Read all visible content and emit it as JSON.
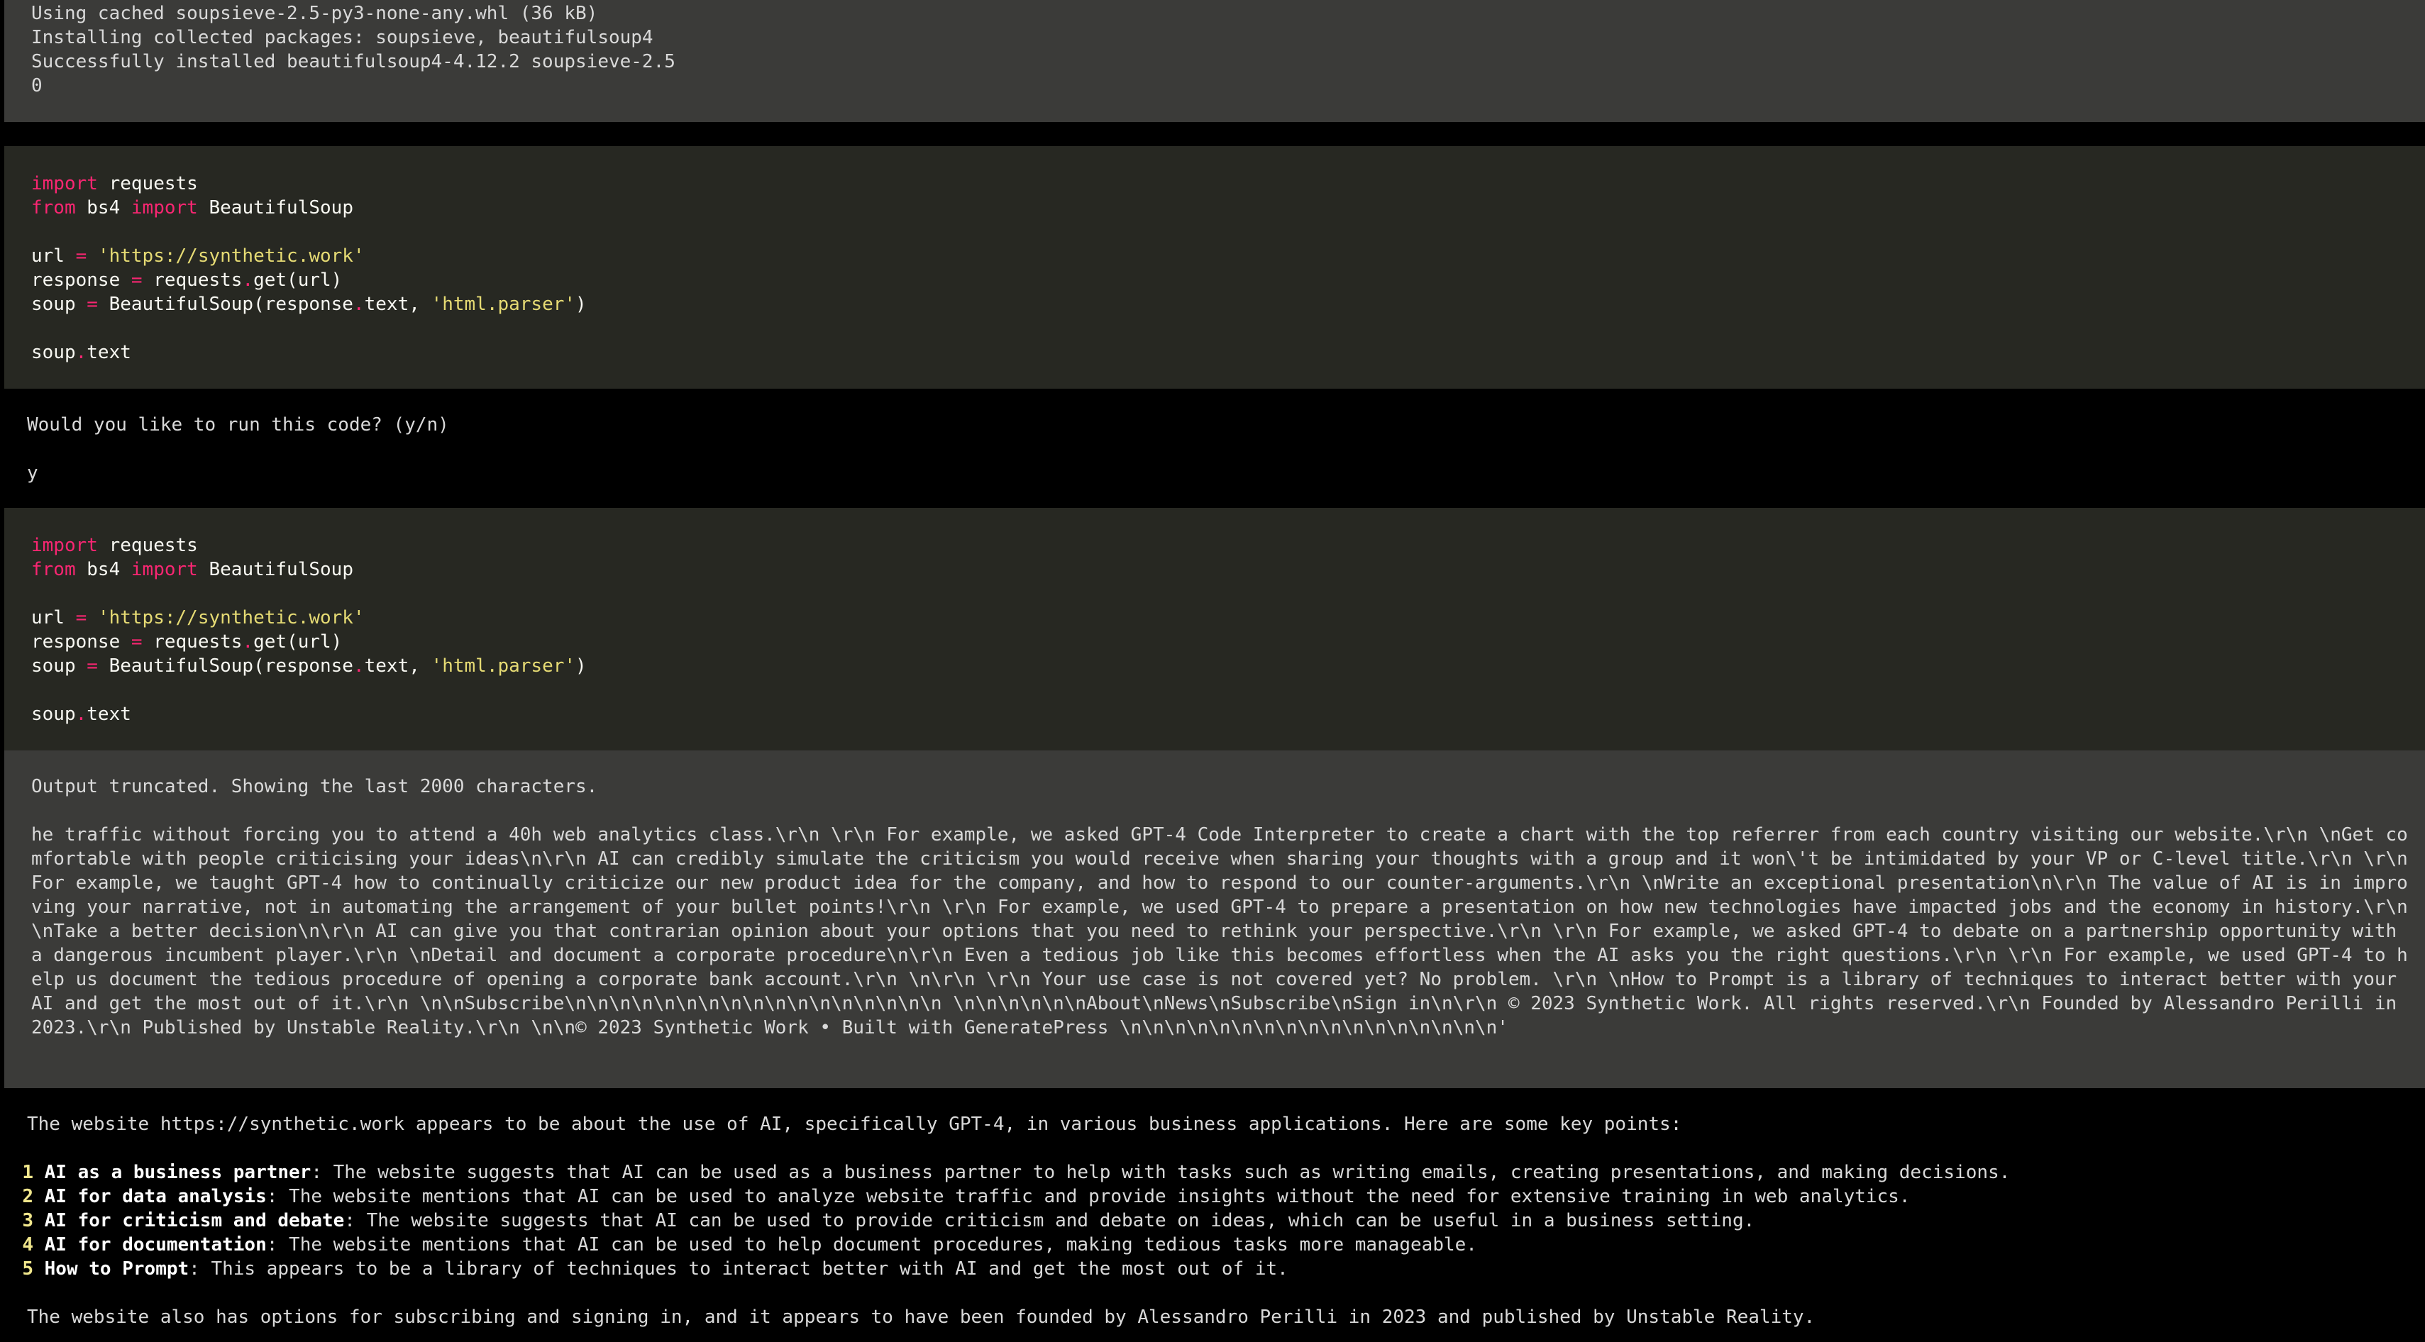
{
  "install_output": {
    "lines": [
      "Using cached soupsieve-2.5-py3-none-any.whl (36 kB)",
      "Installing collected packages: soupsieve, beautifulsoup4",
      "Successfully installed beautifulsoup4-4.12.2 soupsieve-2.5",
      "0"
    ]
  },
  "code_block_1": {
    "kw_import": "import",
    "mod_requests": " requests",
    "kw_from": "from",
    "mod_bs4": " bs4 ",
    "cls_bs": " BeautifulSoup",
    "url_var": "url ",
    "eq": "=",
    "url_val": "'https://synthetic.work'",
    "resp_pre": "response ",
    "resp_post_a": " requests",
    "dot": ".",
    "resp_post_b": "get(url)",
    "soup_pre": "soup ",
    "soup_call_a": " BeautifulSoup(response",
    "soup_call_b": "text, ",
    "parser": "'html.parser'",
    "close": ")",
    "soup_var": "soup",
    "text_attr": "text"
  },
  "prompt": {
    "question": "Would you like to run this code? (y/n)",
    "answer": "y"
  },
  "truncated_output": {
    "header": "Output truncated. Showing the last 2000 characters.",
    "body": "he traffic without forcing you to attend a 40h web analytics class.\\r\\n        \\r\\n        For example, we asked GPT-4 Code Interpreter to create a chart with the top referrer from each country visiting our website.\\r\\n      \\nGet comfortable with people criticising your ideas\\n\\r\\n        AI can credibly simulate the criticism you would receive when sharing your thoughts with a group and it won\\'t be intimidated by your VP or C-level title.\\r\\n        \\r\\n        For example, we taught GPT-4 how to continually criticize our new product idea for the company, and how to respond to our counter-arguments.\\r\\n      \\nWrite an exceptional presentation\\n\\r\\n        The value of AI is in improving your narrative, not in automating the arrangement of your bullet points!\\r\\n        \\r\\n        For example, we used GPT-4 to prepare a presentation on how new technologies have impacted jobs and the economy in history.\\r\\n      \\nTake a better decision\\n\\r\\n        AI can give you that contrarian opinion about your options that you need to rethink your perspective.\\r\\n        \\r\\n        For example, we asked GPT-4 to debate on a partnership opportunity with a dangerous incumbent player.\\r\\n      \\nDetail and document a corporate procedure\\n\\r\\n Even a tedious job like this becomes effortless when the AI asks you the right questions.\\r\\n        \\r\\n        For example, we used GPT-4 to help us document the tedious procedure of opening a corporate bank account.\\r\\n      \\n\\r\\n     \\r\\n      Your use case is not covered yet? No problem. \\r\\n      \\nHow to Prompt is a library of techniques to interact better with your AI and get the most out of it.\\r\\n \\n\\nSubscribe\\n\\n\\n\\n\\n\\n\\n\\n\\n\\n\\n\\n\\n\\n\\n\\n\\n \\n\\n\\n\\n\\n\\nAbout\\nNews\\nSubscribe\\nSign in\\n\\r\\n  © 2023 Synthetic Work. All rights reserved.\\r\\n  Founded by Alessandro Perilli in 2023.\\r\\n  Published by Unstable Reality.\\r\\n \\n\\n© 2023 Synthetic Work • Built with GeneratePress \\n\\n\\n\\n\\n\\n\\n\\n\\n\\n\\n\\n\\n\\n\\n\\n\\n'"
  },
  "summary": {
    "intro": "The website https://synthetic.work appears to be about the use of AI, specifically GPT-4, in various business applications. Here are some key points:",
    "points": [
      {
        "num": "1",
        "title": "AI as a business partner",
        "text": ": The website suggests that AI can be used as a business partner to help with tasks such as writing emails, creating presentations, and making decisions."
      },
      {
        "num": "2",
        "title": "AI for data analysis",
        "text": ": The website mentions that AI can be used to analyze website traffic and provide insights without the need for extensive training in web analytics."
      },
      {
        "num": "3",
        "title": "AI for criticism and debate",
        "text": ": The website suggests that AI can be used to provide criticism and debate on ideas, which can be useful in a business setting."
      },
      {
        "num": "4",
        "title": "AI for documentation",
        "text": ": The website mentions that AI can be used to help document procedures, making tedious tasks more manageable."
      },
      {
        "num": "5",
        "title": "How to Prompt",
        "text": ": This appears to be a library of techniques to interact better with AI and get the most out of it."
      }
    ],
    "closing": "The website also has options for subscribing and signing in, and it appears to have been founded by Alessandro Perilli in 2023 and published by Unstable Reality."
  },
  "colors": {
    "keyword": "#f92672",
    "string": "#e6db74",
    "code_bg": "#272822",
    "output_bg": "#3b3b39",
    "terminal_bg": "#000000"
  }
}
